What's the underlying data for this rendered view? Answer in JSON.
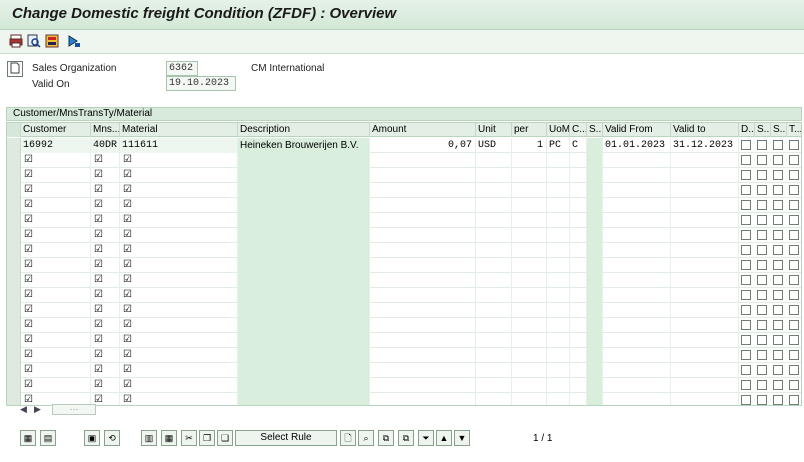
{
  "window": {
    "title": "Change Domestic freight Condition (ZFDF) : Overview"
  },
  "toolbar": {
    "icons": [
      "print-icon",
      "find-icon",
      "settings-icon",
      "navigate-icon"
    ]
  },
  "header": {
    "sales_org_label": "Sales Organization",
    "sales_org_value": "6362",
    "sales_org_desc": "CM International",
    "valid_on_label": "Valid On",
    "valid_on_value": "19.10.2023"
  },
  "section": {
    "title": "Customer/MnsTransTy/Material"
  },
  "table": {
    "columns": [
      "Customer",
      "Mns...",
      "Material",
      "Description",
      "Amount",
      "Unit",
      "per",
      "UoM",
      "C...",
      "S...",
      "Valid From",
      "Valid to",
      "D...",
      "S...",
      "S...",
      "T..."
    ],
    "first_row": {
      "customer": "16992",
      "mns": "40DR",
      "material": "111611",
      "description": "Heineken Brouwerijen B.V.",
      "amount": "0,07",
      "unit": "USD",
      "per": "1",
      "uom": "PC",
      "c": "C",
      "valid_from": "01.01.2023",
      "valid_to": "31.12.2023"
    }
  },
  "scroll": {
    "left": "◀",
    "right": "▶",
    "thumb": "⋯"
  },
  "bottom": {
    "select_rule_label": "Select Rule",
    "page_indicator": "1 / 1"
  }
}
